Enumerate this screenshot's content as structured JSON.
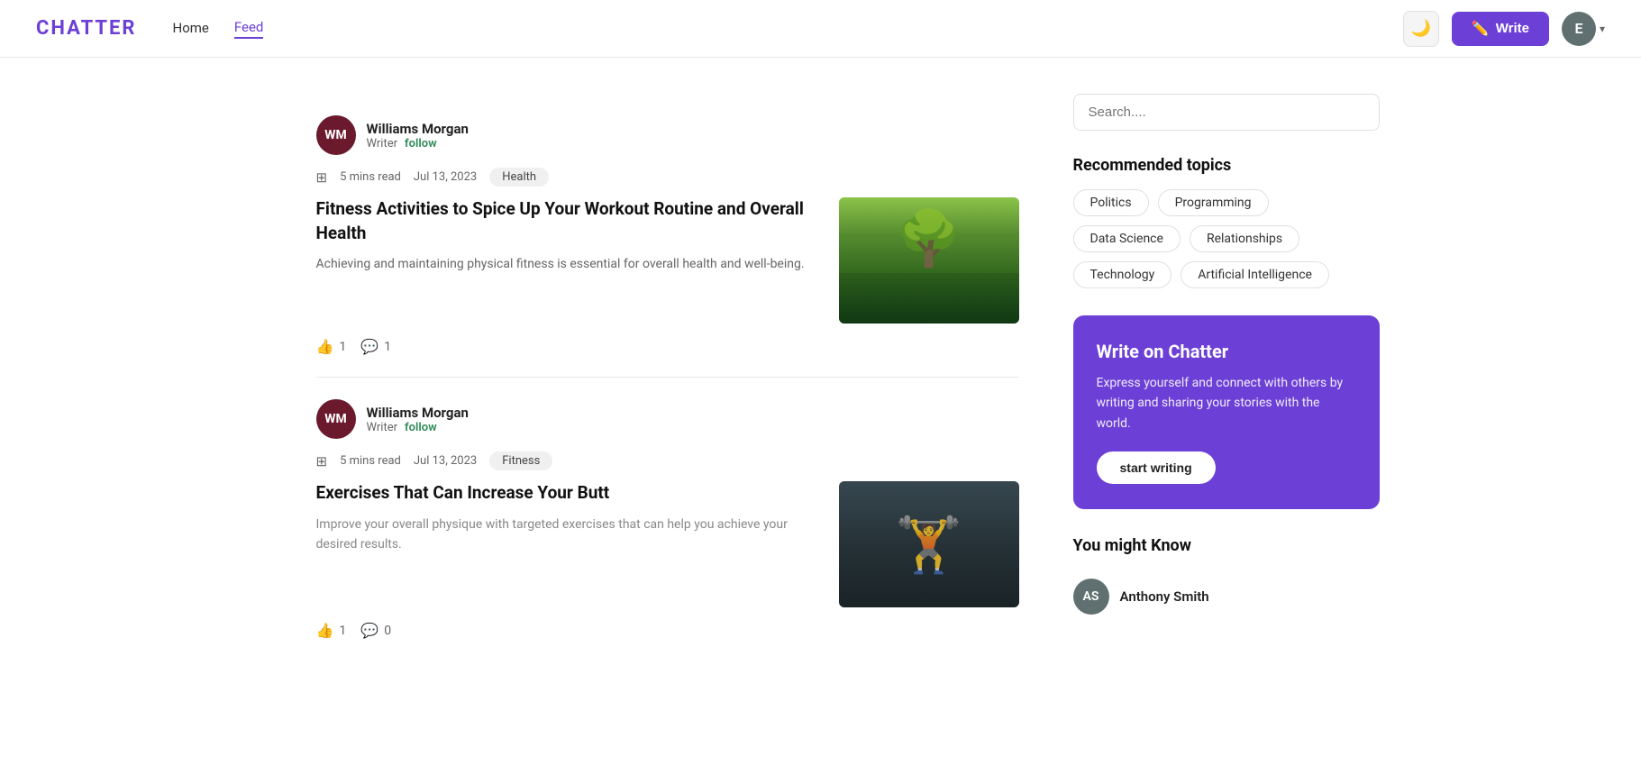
{
  "header": {
    "logo": "CHATTER",
    "nav": [
      {
        "label": "Home",
        "active": false
      },
      {
        "label": "Feed",
        "active": true
      }
    ],
    "darkmode_icon": "🌙",
    "write_label": "Write",
    "write_icon": "✏️",
    "avatar_initial": "E"
  },
  "articles": [
    {
      "id": "article-1",
      "author_initials": "WM",
      "author_name": "Williams Morgan",
      "author_role": "Writer",
      "follow_label": "follow",
      "read_time": "5 mins read",
      "date": "Jul 13, 2023",
      "tag": "Health",
      "title": "Fitness Activities to Spice Up Your Workout Routine and Overall Health",
      "excerpt": "Achieving and maintaining physical fitness is essential for overall health and well-being.",
      "image_type": "forest",
      "likes": 1,
      "comments": 1
    },
    {
      "id": "article-2",
      "author_initials": "WM",
      "author_name": "Williams Morgan",
      "author_role": "Writer",
      "follow_label": "follow",
      "read_time": "5 mins read",
      "date": "Jul 13, 2023",
      "tag": "Fitness",
      "title": "Exercises That Can Increase Your Butt",
      "excerpt": "Improve your overall physique with targeted exercises that can help you achieve your desired results.",
      "image_type": "gym",
      "likes": 1,
      "comments": 0
    }
  ],
  "sidebar": {
    "search_placeholder": "Search....",
    "recommended_title": "Recommended topics",
    "topics": [
      "Politics",
      "Programming",
      "Data Science",
      "Relationships",
      "Technology",
      "Artificial Intelligence"
    ],
    "write_cta": {
      "title": "Write on Chatter",
      "description": "Express yourself and connect with others by writing and sharing your stories with the world.",
      "button_label": "start writing"
    },
    "you_might_know_title": "You might Know",
    "suggestions": [
      {
        "name": "Anthony Smith",
        "initials": "AS"
      }
    ]
  }
}
